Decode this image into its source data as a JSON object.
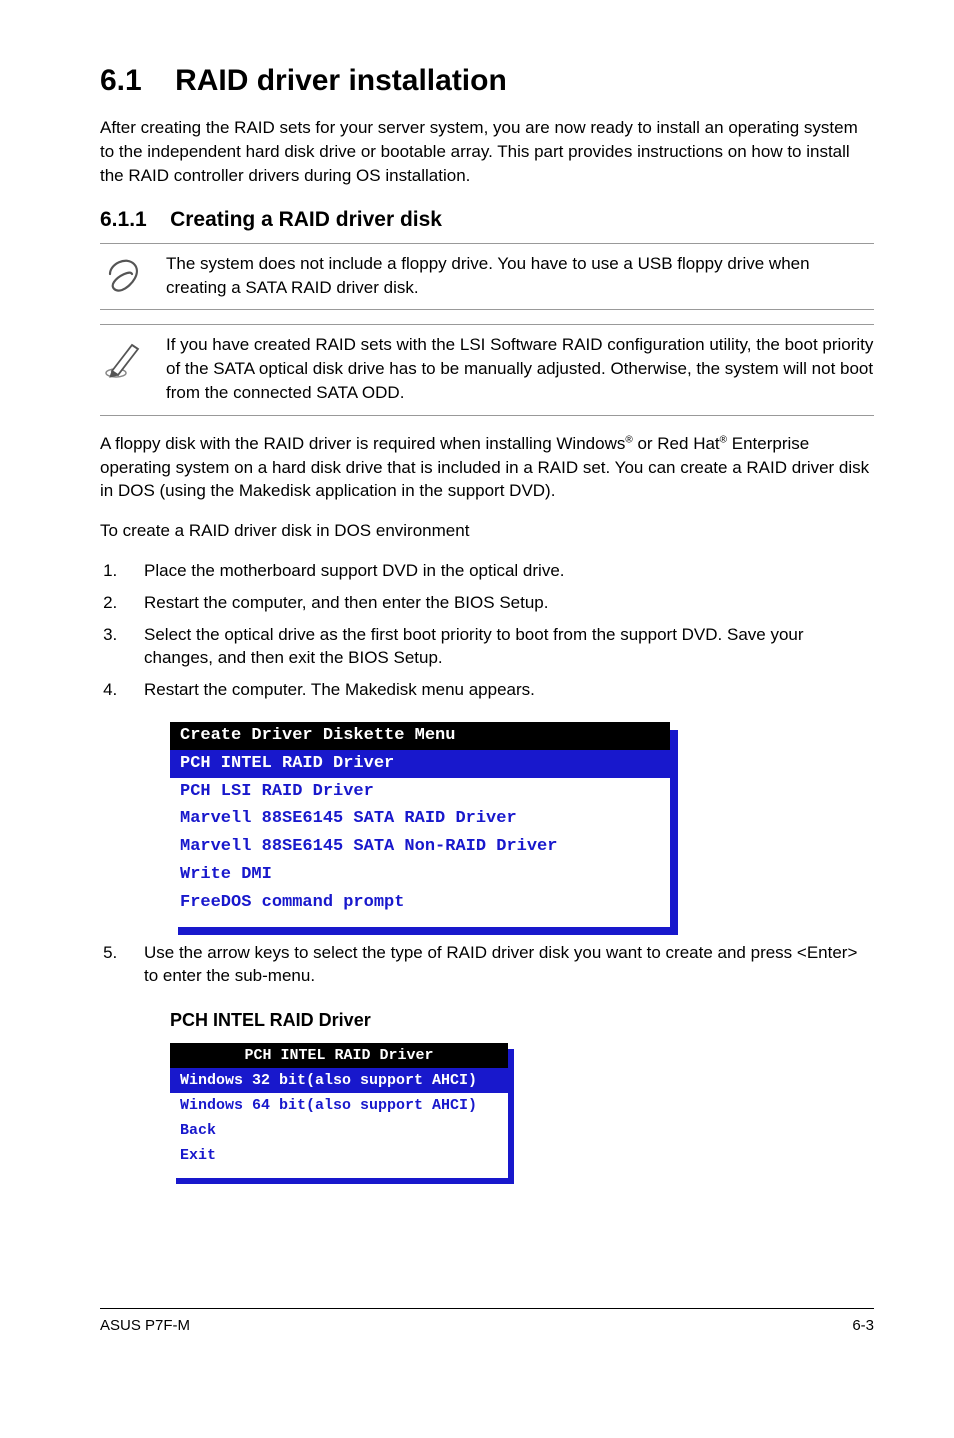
{
  "title_num": "6.1",
  "title_text": "RAID driver installation",
  "intro": "After creating the RAID sets for your server system, you are now ready to install an operating system to the independent hard disk drive or bootable array. This part provides instructions on how to install the RAID controller drivers during OS installation.",
  "subtitle_num": "6.1.1",
  "subtitle_text": "Creating a RAID driver disk",
  "note1": "The system does not include a floppy drive. You have to use a USB floppy drive when creating a SATA RAID driver disk.",
  "note2": "If you have created RAID sets with the LSI Software RAID configuration utility, the boot priority of the SATA optical disk drive has to be manually adjusted. Otherwise, the system will not boot from the connected SATA ODD.",
  "para1_a": "A floppy disk with the RAID driver is required when installing Windows",
  "para1_b": " or Red Hat",
  "para1_c": " Enterprise operating system on a hard disk drive that is included in a RAID set. You can create a RAID driver disk in DOS (using the Makedisk application in the support DVD).",
  "para2": "To create a RAID driver disk in DOS environment",
  "steps": [
    "Place the motherboard support DVD in the optical drive.",
    "Restart the computer, and then enter the BIOS Setup.",
    "Select the optical drive as the first boot priority to boot from the support DVD. Save your changes, and then exit the BIOS Setup.",
    "Restart the computer. The Makedisk menu appears."
  ],
  "menu1_header": "Create Driver Diskette Menu",
  "menu1_selected": "PCH INTEL RAID Driver",
  "menu1_items": [
    "PCH LSI RAID Driver",
    "Marvell 88SE6145 SATA RAID Driver",
    "Marvell 88SE6145 SATA Non-RAID Driver",
    "Write DMI",
    "FreeDOS command prompt"
  ],
  "step5": "Use the arrow keys to select the type of RAID driver disk you want to create and press <Enter> to enter the sub-menu.",
  "subhead2": "PCH INTEL RAID Driver",
  "menu2_header": "PCH INTEL RAID Driver",
  "menu2_selected": "Windows 32 bit(also support AHCI)",
  "menu2_items": [
    "Windows 64 bit(also support AHCI)",
    "Back",
    "Exit"
  ],
  "footer_left": "ASUS P7F-M",
  "footer_right": "6-3"
}
